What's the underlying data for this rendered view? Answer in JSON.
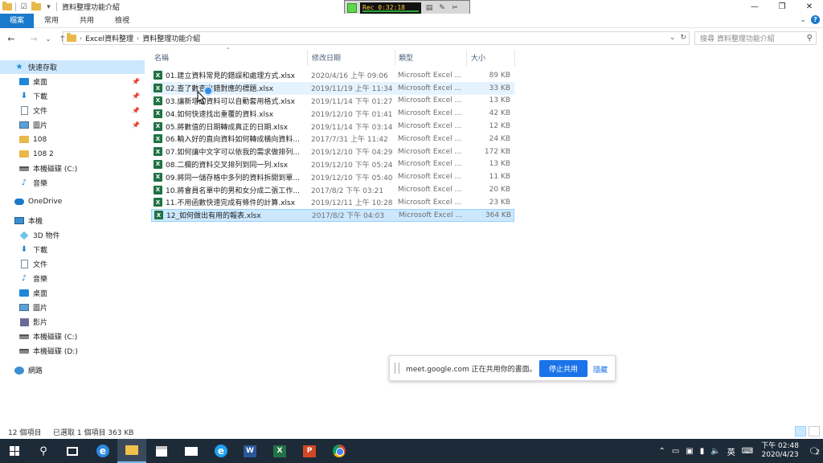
{
  "window": {
    "title": "資料整理功能介紹",
    "controls": [
      "—",
      "❐",
      "✕"
    ]
  },
  "recorder": {
    "time": "Rec 0:32:18"
  },
  "ribbon": {
    "tabs": [
      "檔案",
      "常用",
      "共用",
      "檢視"
    ]
  },
  "address": {
    "crumbs": [
      "Excel資料整理",
      "資料整理功能介紹"
    ],
    "search_placeholder": "搜尋 資料整理功能介紹"
  },
  "sidebar": {
    "quick_access": "快速存取",
    "quick_items": [
      {
        "label": "桌面",
        "pinned": true
      },
      {
        "label": "下載",
        "pinned": true
      },
      {
        "label": "文件",
        "pinned": true
      },
      {
        "label": "圖片",
        "pinned": true
      },
      {
        "label": "108",
        "pinned": false
      },
      {
        "label": "108 2",
        "pinned": false
      },
      {
        "label": "本機磁碟 (C:)",
        "pinned": false
      },
      {
        "label": "音樂",
        "pinned": false
      }
    ],
    "onedrive": "OneDrive",
    "this_pc": "本機",
    "pc_items": [
      "3D 物件",
      "下載",
      "文件",
      "音樂",
      "桌面",
      "圖片",
      "影片",
      "本機磁碟 (C:)",
      "本機磁碟 (D:)"
    ],
    "network": "網路"
  },
  "columns": {
    "name": "名稱",
    "date": "修改日期",
    "type": "類型",
    "size": "大小"
  },
  "files": [
    {
      "name": "01.建立資料常見的錯誤和處理方式.xlsx",
      "date": "2020/4/16 上午 09:06",
      "type": "Microsoft Excel ...",
      "size": "89 KB"
    },
    {
      "name": "02.查了數查出錯對應的標題.xlsx",
      "date": "2019/11/19 上午 11:34",
      "type": "Microsoft Excel ...",
      "size": "33 KB"
    },
    {
      "name": "03.讓新增的資料可以自動套用格式.xlsx",
      "date": "2019/11/14 下午 01:27",
      "type": "Microsoft Excel ...",
      "size": "13 KB"
    },
    {
      "name": "04.如何快速找出重覆的資料.xlsx",
      "date": "2019/12/10 下午 01:41",
      "type": "Microsoft Excel ...",
      "size": "42 KB"
    },
    {
      "name": "05.將數值的日期轉成真正的日期.xlsx",
      "date": "2019/11/14 下午 03:14",
      "type": "Microsoft Excel ...",
      "size": "12 KB"
    },
    {
      "name": "06.輸入好的直向資料如何轉成橫向資料...",
      "date": "2017/7/31 上午 11:42",
      "type": "Microsoft Excel ...",
      "size": "24 KB"
    },
    {
      "name": "07.如何讓中文字可以依我的需求做排列...",
      "date": "2019/12/10 下午 04:29",
      "type": "Microsoft Excel ...",
      "size": "172 KB"
    },
    {
      "name": "08.二欄的資料交叉排列到同一列.xlsx",
      "date": "2019/12/10 下午 05:24",
      "type": "Microsoft Excel ...",
      "size": "13 KB"
    },
    {
      "name": "09.將同一儲存格中多列的資料拆開到單...",
      "date": "2019/12/10 下午 05:40",
      "type": "Microsoft Excel ...",
      "size": "11 KB"
    },
    {
      "name": "10.將會員名單中的男和女分成二張工作...",
      "date": "2017/8/2 下午 03:21",
      "type": "Microsoft Excel ...",
      "size": "20 KB"
    },
    {
      "name": "11.不用函數快速完成有條件的計算.xlsx",
      "date": "2019/12/11 上午 10:28",
      "type": "Microsoft Excel ...",
      "size": "23 KB"
    },
    {
      "name": "12_如何做出有用的報表.xlsx",
      "date": "2017/8/2 下午 04:03",
      "type": "Microsoft Excel ...",
      "size": "364 KB"
    }
  ],
  "share": {
    "text": "meet.google.com 正在共用你的畫面。",
    "stop": "停止共用",
    "hide": "隱藏"
  },
  "status": {
    "count": "12 個項目",
    "selected": "已選取 1 個項目  363 KB"
  },
  "taskbar": {
    "time": "下午 02:48",
    "date": "2020/4/23",
    "ime": "英",
    "notifications": "2"
  }
}
